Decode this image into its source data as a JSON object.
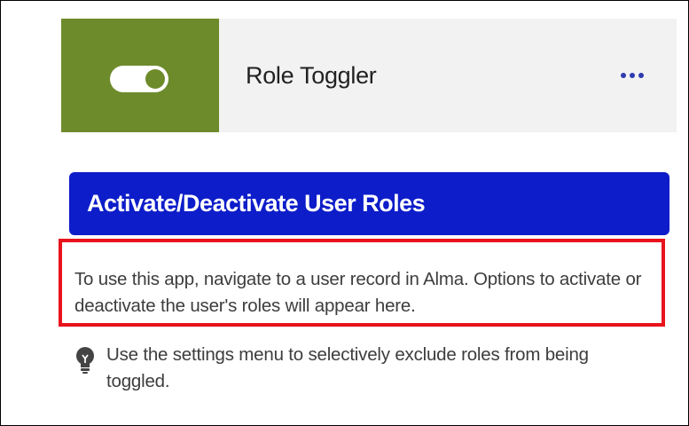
{
  "app": {
    "title": "Role Toggler",
    "accent_color": "#6e8b2b",
    "icon": "toggle-on-icon",
    "menu_icon": "more-horizontal-icon"
  },
  "banner": {
    "text": "Activate/Deactivate User Roles",
    "color": "#0d1dc9"
  },
  "instructions": {
    "text": "To use this app, navigate to a user record in Alma. Options to activate or deactivate the user's roles will appear here.",
    "highlight_color": "#e8131c"
  },
  "tip": {
    "icon": "lightbulb-icon",
    "text": "Use the settings menu to selectively exclude roles from being toggled."
  }
}
